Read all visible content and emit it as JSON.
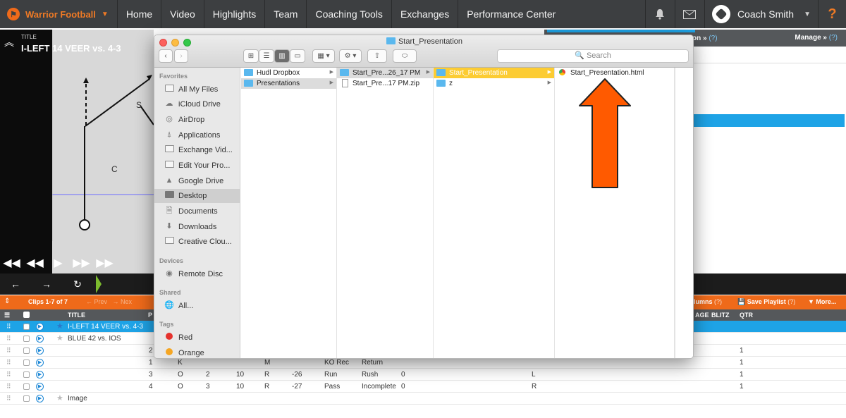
{
  "nav": {
    "brand": "Warrior Football",
    "links": [
      "Home",
      "Video",
      "Highlights",
      "Team",
      "Coaching Tools",
      "Exchanges",
      "Performance Center"
    ],
    "user": "Coach Smith",
    "help": "?"
  },
  "video": {
    "title_small": "TITLE",
    "title": "I-LEFT 14 VEER vs. 4-3",
    "label_c": "C",
    "label_s": "S"
  },
  "right_panel": {
    "tab_label": "on »",
    "tab_help": "(?)",
    "manage": "Manage »"
  },
  "clipbar": {
    "count": "Clips 1-7 of 7",
    "prev": "← Prev",
    "next": "→ Nex",
    "columns": "lumns",
    "columns_help": "(?)",
    "save": "Save Playlist",
    "save_help": "(?)",
    "more": "More..."
  },
  "table": {
    "headers": [
      "TITLE",
      "P",
      "AGE",
      "BLITZ",
      "QTR"
    ],
    "rows": [
      {
        "title": "I-LEFT 14 VEER vs. 4-3",
        "cells": []
      },
      {
        "title": "BLUE 42 vs. IOS",
        "cells": []
      },
      {
        "title": "",
        "cells": [
          "2",
          "",
          "",
          "",
          "",
          "",
          "",
          "",
          "",
          "",
          "1"
        ]
      },
      {
        "title": "",
        "cells": [
          "1",
          "K",
          "",
          "",
          "M",
          "",
          "KO Rec",
          "Return",
          "",
          "",
          "1"
        ]
      },
      {
        "title": "",
        "cells": [
          "3",
          "O",
          "2",
          "10",
          "R",
          "-26",
          "Run",
          "Rush",
          "0",
          "L",
          "1"
        ]
      },
      {
        "title": "",
        "cells": [
          "4",
          "O",
          "3",
          "10",
          "R",
          "-27",
          "Pass",
          "Incomplete",
          "0",
          "R",
          "1"
        ]
      },
      {
        "title": "Image",
        "cells": []
      }
    ]
  },
  "finder": {
    "title": "Start_Presentation",
    "search_placeholder": "Search",
    "sidebar": {
      "favorites_label": "Favorites",
      "favorites": [
        {
          "label": "All My Files",
          "icon": "all-files-icon"
        },
        {
          "label": "iCloud Drive",
          "icon": "cloud-icon"
        },
        {
          "label": "AirDrop",
          "icon": "airdrop-icon"
        },
        {
          "label": "Applications",
          "icon": "applications-icon"
        },
        {
          "label": "Exchange Vid...",
          "icon": "folder-icon"
        },
        {
          "label": "Edit Your Pro...",
          "icon": "folder-icon"
        },
        {
          "label": "Google Drive",
          "icon": "google-drive-icon"
        },
        {
          "label": "Desktop",
          "icon": "desktop-icon"
        },
        {
          "label": "Documents",
          "icon": "documents-icon"
        },
        {
          "label": "Downloads",
          "icon": "downloads-icon"
        },
        {
          "label": "Creative Clou...",
          "icon": "creative-cloud-icon"
        }
      ],
      "devices_label": "Devices",
      "devices": [
        {
          "label": "Remote Disc",
          "icon": "disc-icon"
        }
      ],
      "shared_label": "Shared",
      "shared": [
        {
          "label": "All...",
          "icon": "network-icon"
        }
      ],
      "tags_label": "Tags",
      "tags": [
        {
          "label": "Red",
          "color": "#e5322d"
        },
        {
          "label": "Orange",
          "color": "#f5a623"
        }
      ]
    },
    "columns": [
      [
        {
          "label": "Hudl Dropbox",
          "kind": "folder"
        },
        {
          "label": "Presentations",
          "kind": "folder"
        }
      ],
      [
        {
          "label": "Start_Pre...26_17 PM",
          "kind": "folder"
        },
        {
          "label": "Start_Pre...17 PM.zip",
          "kind": "file"
        }
      ],
      [
        {
          "label": "Start_Presentation",
          "kind": "folder"
        },
        {
          "label": "z",
          "kind": "folder"
        }
      ],
      [
        {
          "label": "Start_Presentation.html",
          "kind": "html"
        }
      ]
    ]
  },
  "colors": {
    "brand_orange": "#ef6a1a",
    "selection_blue": "#1ea3e6",
    "annotation_arrow": "#ff5a00"
  }
}
